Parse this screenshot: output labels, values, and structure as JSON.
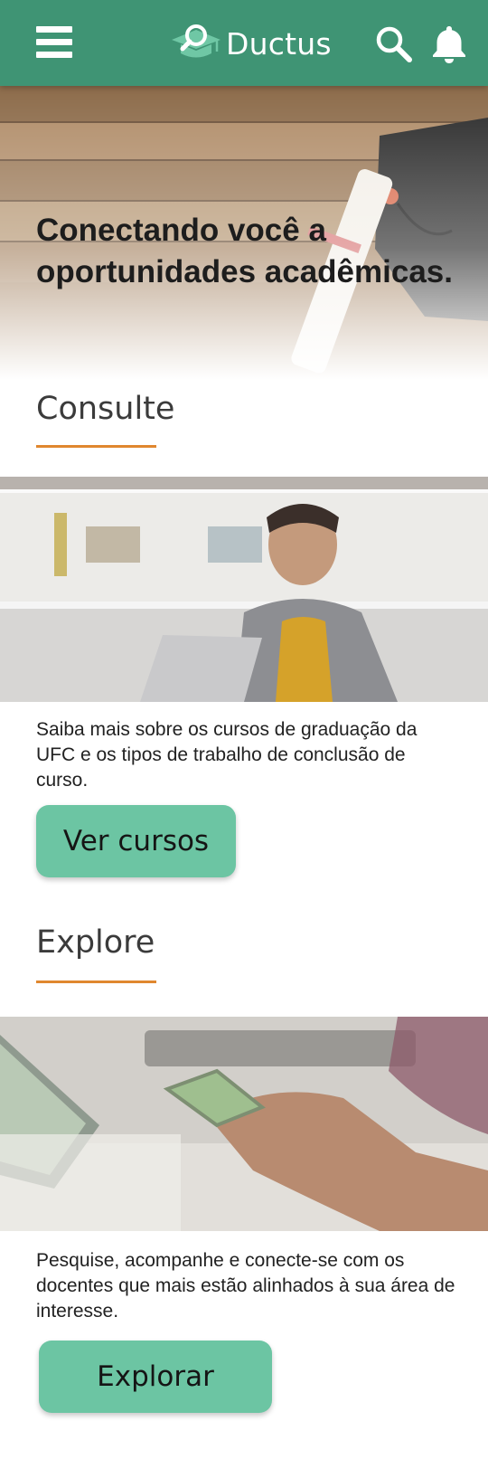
{
  "app": {
    "name": "Ductus"
  },
  "header": {
    "menu_icon": "menu-icon",
    "logo_icon": "graduation-cap-search-icon",
    "search_icon": "search-icon",
    "notification_icon": "bell-icon"
  },
  "hero": {
    "title": "Conectando você a oportunidades acadêmicas."
  },
  "sections": {
    "consulte": {
      "title": "Consulte",
      "description": "Saiba mais sobre os cursos de graduação da UFC e os tipos de trabalho de conclusão de curso.",
      "button_label": "Ver cursos"
    },
    "explore": {
      "title": "Explore",
      "description": "Pesquise, acompanhe e conecte-se com os docentes que mais estão alinhados à sua área de interesse.",
      "button_label": "Explorar"
    }
  },
  "colors": {
    "header_bg": "#3f9474",
    "accent_underline": "#e0872f",
    "button_bg": "#6cc5a3"
  }
}
